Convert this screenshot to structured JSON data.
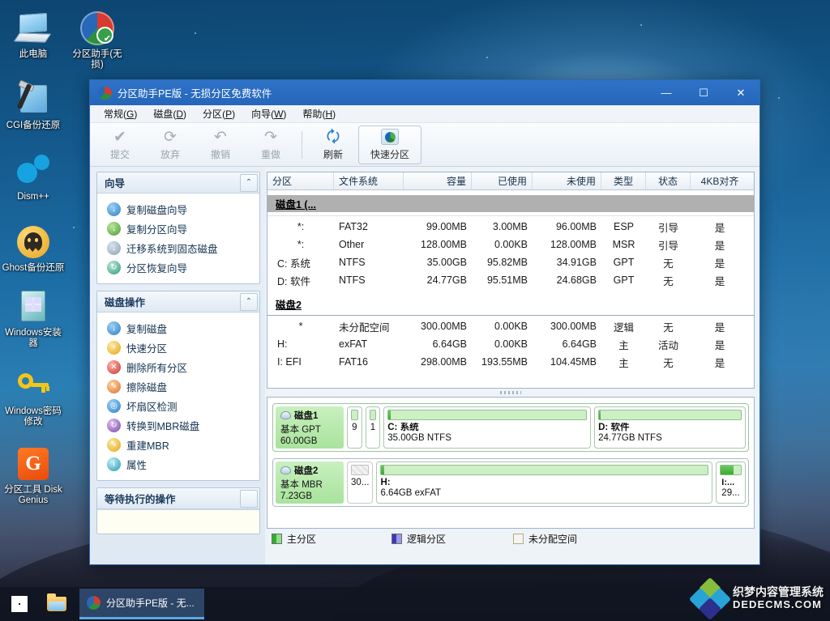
{
  "desktop": {
    "icons": [
      {
        "label": "此电脑",
        "icon": "this-pc-icon"
      },
      {
        "label": "分区助手(无损)",
        "icon": "partition-assistant-icon"
      },
      {
        "label": "CGI备份还原",
        "icon": "cgi-backup-icon"
      },
      {
        "label": "Dism++",
        "icon": "dism-icon"
      },
      {
        "label": "Ghost备份还原",
        "icon": "ghost-backup-icon"
      },
      {
        "label": "Windows安装器",
        "icon": "windows-installer-icon"
      },
      {
        "label": "Windows密码修改",
        "icon": "windows-password-icon"
      },
      {
        "label": "分区工具 DiskGenius",
        "icon": "diskgenius-icon"
      }
    ]
  },
  "taskbar": {
    "start_label": "",
    "explorer_label": "",
    "task_item": "分区助手PE版 - 无...",
    "watermark_line1": "织梦内容管理系统",
    "watermark_line2": "DEDECMS.COM"
  },
  "window": {
    "title": "分区助手PE版 - 无损分区免费软件",
    "minimize": "—",
    "maximize": "☐",
    "close": "✕"
  },
  "menu": [
    {
      "label": "常规(G)",
      "key": "G",
      "text": "常规"
    },
    {
      "label": "磁盘(D)",
      "key": "D",
      "text": "磁盘"
    },
    {
      "label": "分区(P)",
      "key": "P",
      "text": "分区"
    },
    {
      "label": "向导(W)",
      "key": "W",
      "text": "向导"
    },
    {
      "label": "帮助(H)",
      "key": "H",
      "text": "帮助"
    }
  ],
  "toolbar": {
    "buttons": [
      {
        "label": "提交",
        "icon": "check-icon",
        "glyph": "✔",
        "disabled": true
      },
      {
        "label": "放弃",
        "icon": "discard-icon",
        "glyph": "⟳",
        "disabled": true
      },
      {
        "label": "撤销",
        "icon": "undo-icon",
        "glyph": "↶",
        "disabled": true
      },
      {
        "label": "重做",
        "icon": "redo-icon",
        "glyph": "↷",
        "disabled": true
      }
    ],
    "refresh": {
      "label": "刷新",
      "icon": "refresh-icon",
      "glyph": "🗘"
    },
    "quick_partition": {
      "label": "快速分区",
      "icon": "quick-partition-icon"
    }
  },
  "sidebar": {
    "panels": [
      {
        "title": "向导",
        "collapse_glyph": "⌃",
        "items": [
          {
            "label": "复制磁盘向导",
            "icon": "copy-disk-icon",
            "color": "blue"
          },
          {
            "label": "复制分区向导",
            "icon": "copy-partition-icon",
            "color": "green"
          },
          {
            "label": "迁移系统到固态磁盘",
            "icon": "migrate-os-icon",
            "color": "gray"
          },
          {
            "label": "分区恢复向导",
            "icon": "partition-recovery-icon",
            "color": "teal"
          }
        ]
      },
      {
        "title": "磁盘操作",
        "collapse_glyph": "⌃",
        "items": [
          {
            "label": "复制磁盘",
            "icon": "copy-disk-icon",
            "color": "blue"
          },
          {
            "label": "快速分区",
            "icon": "quick-partition-icon",
            "color": "yellow"
          },
          {
            "label": "删除所有分区",
            "icon": "delete-all-partitions-icon",
            "color": "red"
          },
          {
            "label": "擦除磁盘",
            "icon": "wipe-disk-icon",
            "color": "orange"
          },
          {
            "label": "坏扇区检测",
            "icon": "bad-sector-check-icon",
            "color": "blue"
          },
          {
            "label": "转换到MBR磁盘",
            "icon": "convert-mbr-icon",
            "color": "purple"
          },
          {
            "label": "重建MBR",
            "icon": "rebuild-mbr-icon",
            "color": "yellow"
          },
          {
            "label": "属性",
            "icon": "properties-icon",
            "color": "cyan"
          }
        ]
      },
      {
        "title": "等待执行的操作",
        "collapse_glyph": "",
        "items": []
      }
    ]
  },
  "table": {
    "columns": [
      "分区",
      "文件系统",
      "容量",
      "已使用",
      "未使用",
      "类型",
      "状态",
      "4KB对齐"
    ],
    "groups": [
      {
        "name": "磁盘1 (...",
        "rows": [
          {
            "partition": "*:",
            "fs": "FAT32",
            "capacity": "99.00MB",
            "used": "3.00MB",
            "unused": "96.00MB",
            "type": "ESP",
            "status": "引导",
            "aligned": "是"
          },
          {
            "partition": "*:",
            "fs": "Other",
            "capacity": "128.00MB",
            "used": "0.00KB",
            "unused": "128.00MB",
            "type": "MSR",
            "status": "引导",
            "aligned": "是"
          },
          {
            "partition": "C: 系统",
            "fs": "NTFS",
            "capacity": "35.00GB",
            "used": "95.82MB",
            "unused": "34.91GB",
            "type": "GPT",
            "status": "无",
            "aligned": "是"
          },
          {
            "partition": "D: 软件",
            "fs": "NTFS",
            "capacity": "24.77GB",
            "used": "95.51MB",
            "unused": "24.68GB",
            "type": "GPT",
            "status": "无",
            "aligned": "是"
          }
        ]
      },
      {
        "name": "磁盘2",
        "rows": [
          {
            "partition": "*",
            "fs": "未分配空间",
            "capacity": "300.00MB",
            "used": "0.00KB",
            "unused": "300.00MB",
            "type": "逻辑",
            "status": "无",
            "aligned": "是"
          },
          {
            "partition": "H:",
            "fs": "exFAT",
            "capacity": "6.64GB",
            "used": "0.00KB",
            "unused": "6.64GB",
            "type": "主",
            "status": "活动",
            "aligned": "是"
          },
          {
            "partition": "I: EFI",
            "fs": "FAT16",
            "capacity": "298.00MB",
            "used": "193.55MB",
            "unused": "104.45MB",
            "type": "主",
            "status": "无",
            "aligned": "是"
          }
        ]
      }
    ]
  },
  "disk_map": {
    "disks": [
      {
        "name": "磁盘1",
        "scheme": "基本 GPT",
        "size": "60.00GB",
        "partitions": [
          {
            "label": "",
            "detail": "9",
            "tiny": true,
            "used_pct": 3,
            "flex": 2,
            "unallocated": false
          },
          {
            "label": "",
            "detail": "1",
            "tiny": true,
            "used_pct": 0,
            "flex": 2,
            "unallocated": false
          },
          {
            "label": "C: 系统",
            "detail": "35.00GB NTFS",
            "tiny": false,
            "used_pct": 1,
            "flex": 57,
            "unallocated": false
          },
          {
            "label": "D: 软件",
            "detail": "24.77GB NTFS",
            "tiny": false,
            "used_pct": 1,
            "flex": 41,
            "unallocated": false
          }
        ]
      },
      {
        "name": "磁盘2",
        "scheme": "基本 MBR",
        "size": "7.23GB",
        "partitions": [
          {
            "label": "",
            "detail": "30...",
            "tiny": true,
            "used_pct": 0,
            "flex": 5,
            "unallocated": true
          },
          {
            "label": "H:",
            "detail": "6.64GB exFAT",
            "tiny": false,
            "used_pct": 1,
            "flex": 90,
            "unallocated": false
          },
          {
            "label": "I:...",
            "detail": "29...",
            "tiny": true,
            "used_pct": 65,
            "flex": 6,
            "unallocated": false
          }
        ]
      }
    ]
  },
  "legend": [
    {
      "label": "主分区",
      "swatch": "primary"
    },
    {
      "label": "逻辑分区",
      "swatch": "logical"
    },
    {
      "label": "未分配空间",
      "swatch": "unalloc"
    }
  ]
}
